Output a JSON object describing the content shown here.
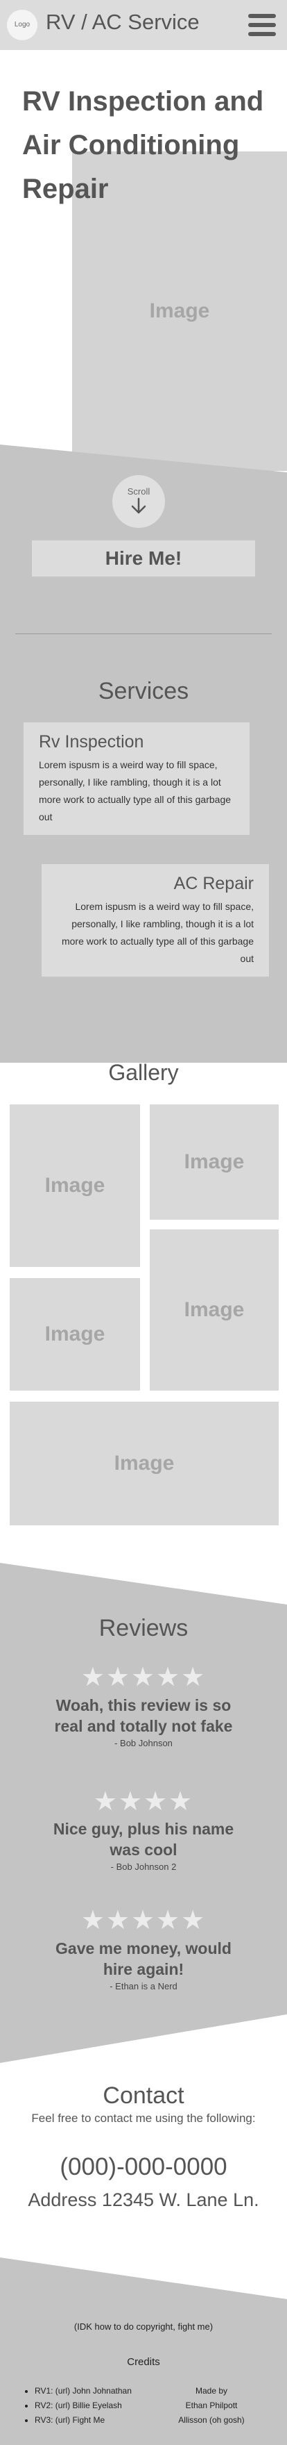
{
  "header": {
    "logo_text": "Logo",
    "site_title": "RV / AC Service"
  },
  "hero": {
    "title": "RV Inspection and Air Conditioning Repair",
    "image_label": "Image",
    "scroll_label": "Scroll",
    "hire_button": "Hire Me!"
  },
  "services": {
    "heading": "Services",
    "items": [
      {
        "title": "Rv Inspection",
        "body": "Lorem ispusm is a weird way to fill space, personally, I like rambling, though it is a lot more work to actually type all of this garbage out"
      },
      {
        "title": "AC Repair",
        "body": "Lorem ispusm is a weird way to fill space, personally, I like rambling, though it is a lot more work to actually type all of this garbage out"
      }
    ]
  },
  "gallery": {
    "heading": "Gallery",
    "tiles": [
      "Image",
      "Image",
      "Image",
      "Image",
      "Image"
    ]
  },
  "reviews": {
    "heading": "Reviews",
    "items": [
      {
        "stars": "★★★★★",
        "text": "Woah, this review is so real and totally not fake",
        "author": "- Bob Johnson"
      },
      {
        "stars": "★★★★",
        "text": "Nice guy, plus his name was cool",
        "author": "- Bob Johnson 2"
      },
      {
        "stars": "★★★★★",
        "text": "Gave me money, would hire again!",
        "author": "- Ethan is a Nerd"
      }
    ]
  },
  "contact": {
    "heading": "Contact",
    "intro": "Feel free to contact me using the following:",
    "phone": "(000)-000-0000",
    "address": "Address 12345 W. Lane Ln."
  },
  "footer": {
    "copyright": "(IDK how to do copyright, fight me)",
    "credits_heading": "Credits",
    "credits": [
      "RV1: (url) John Johnathan",
      "RV2: (url) Billie Eyelash",
      "RV3: (url) Fight Me"
    ],
    "made_by": [
      "Made by",
      "Ethan Philpott",
      "Allisson (oh gosh)"
    ]
  }
}
